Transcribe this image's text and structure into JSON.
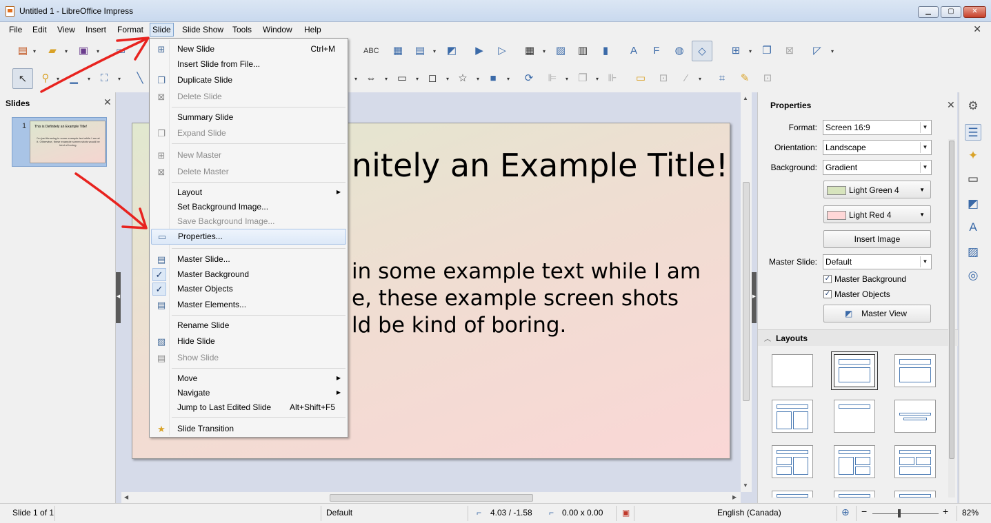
{
  "window": {
    "title": "Untitled 1 - LibreOffice Impress",
    "controls": {
      "minimize_icon": "minimize-icon",
      "maximize_icon": "maximize-icon",
      "close_icon": "close-icon"
    }
  },
  "menubar": {
    "items": [
      "File",
      "Edit",
      "View",
      "Insert",
      "Format",
      "Slide",
      "Slide Show",
      "Tools",
      "Window",
      "Help"
    ],
    "active": "Slide"
  },
  "slides_panel": {
    "title": "Slides",
    "thumbnails": [
      {
        "number": "1",
        "title": "This is Definitely an Example Title!",
        "body": "I'm just throwing in some example text while I am at it. Otherwise, these example screen shots would be kind of boring."
      }
    ]
  },
  "slide": {
    "title": "This is Definitely an Example Title!",
    "title_visible": "nitely an Example Title!",
    "body_lines_visible": [
      "in some example text while I am",
      "e, these example screen shots",
      "ld be kind of boring."
    ]
  },
  "slide_menu": {
    "items": [
      {
        "label": "New Slide",
        "shortcut": "Ctrl+M",
        "icon": "new-slide-icon",
        "enabled": true
      },
      {
        "label": "Insert Slide from File...",
        "enabled": true
      },
      {
        "label": "Duplicate Slide",
        "icon": "duplicate-slide-icon",
        "enabled": true
      },
      {
        "label": "Delete Slide",
        "icon": "delete-slide-icon",
        "enabled": false
      },
      {
        "separator": true
      },
      {
        "label": "Summary Slide",
        "enabled": true
      },
      {
        "label": "Expand Slide",
        "icon": "expand-slide-icon",
        "enabled": false
      },
      {
        "separator": true
      },
      {
        "label": "New Master",
        "icon": "new-master-icon",
        "enabled": false
      },
      {
        "label": "Delete Master",
        "icon": "delete-master-icon",
        "enabled": false
      },
      {
        "separator": true
      },
      {
        "label": "Layout",
        "submenu": true,
        "enabled": true
      },
      {
        "label": "Set Background Image...",
        "enabled": true
      },
      {
        "label": "Save Background Image...",
        "enabled": false
      },
      {
        "label": "Properties...",
        "icon": "slide-properties-icon",
        "enabled": true,
        "highlighted": true
      },
      {
        "separator": true
      },
      {
        "label": "Master Slide...",
        "icon": "master-slide-icon",
        "enabled": true
      },
      {
        "label": "Master Background",
        "checked": true,
        "enabled": true
      },
      {
        "label": "Master Objects",
        "checked": true,
        "enabled": true
      },
      {
        "label": "Master Elements...",
        "icon": "master-elements-icon",
        "enabled": true
      },
      {
        "separator": true
      },
      {
        "label": "Rename Slide",
        "enabled": true
      },
      {
        "label": "Hide Slide",
        "icon": "hide-slide-icon",
        "enabled": true
      },
      {
        "label": "Show Slide",
        "icon": "show-slide-icon",
        "enabled": false
      },
      {
        "separator": true
      },
      {
        "label": "Move",
        "submenu": true,
        "enabled": true
      },
      {
        "label": "Navigate",
        "submenu": true,
        "enabled": true
      },
      {
        "label": "Jump to Last Edited Slide",
        "shortcut": "Alt+Shift+F5",
        "enabled": true
      },
      {
        "separator": true
      },
      {
        "label": "Slide Transition",
        "icon": "slide-transition-icon",
        "enabled": true
      }
    ]
  },
  "properties": {
    "title": "Properties",
    "format_label": "Format:",
    "format_value": "Screen 16:9",
    "orientation_label": "Orientation:",
    "orientation_value": "Landscape",
    "background_label": "Background:",
    "background_value": "Gradient",
    "color1_label": "Light Green 4",
    "color1_hex": "#d7e4bd",
    "color2_label": "Light Red 4",
    "color2_hex": "#ffd7d7",
    "insert_image_label": "Insert Image",
    "master_slide_label": "Master Slide:",
    "master_slide_value": "Default",
    "master_background_label": "Master Background",
    "master_objects_label": "Master Objects",
    "master_view_label": "Master View",
    "layouts_title": "Layouts"
  },
  "statusbar": {
    "slide_pos": "Slide 1 of 1",
    "master": "Default",
    "position": "4.03 / -1.58",
    "size": "0.00 x 0.00",
    "language": "English (Canada)",
    "zoom": "82%"
  },
  "colors": {
    "annotation_red": "#e8231f",
    "menu_highlight": "#dde9f8",
    "slide_gradient_start": "#e1e8cf",
    "slide_gradient_end": "#fad7d6"
  }
}
